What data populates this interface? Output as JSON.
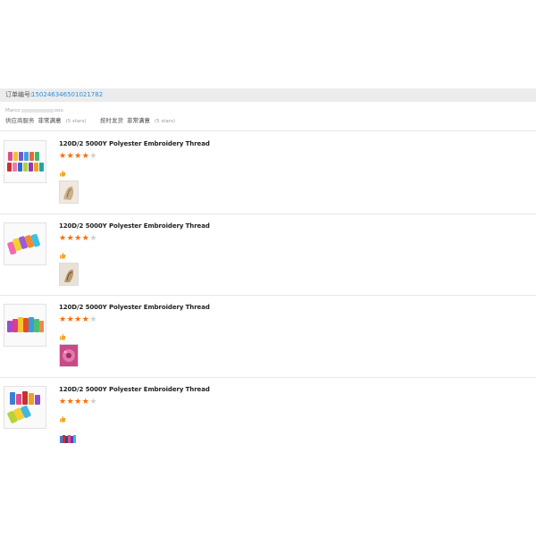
{
  "order": {
    "label": "订单编号:",
    "number": "150246346501021782"
  },
  "buyer": {
    "prefix": "Marco",
    "suffix": "ooo"
  },
  "supplier_ratings": [
    {
      "label": "供应商服务",
      "value": "非常满意",
      "stars": "(5 stars)"
    },
    {
      "label": "按时发货",
      "value": "非常满意",
      "stars": "(5 stars)"
    }
  ],
  "products": [
    {
      "title": "120D/2 5000Y Polyester Embroidery Thread",
      "rating": 4,
      "max_rating": 5,
      "thumb_icon": "thread-spools-image",
      "photo_icon": "review-photo"
    },
    {
      "title": "120D/2 5000Y Polyester Embroidery Thread",
      "rating": 4,
      "max_rating": 5,
      "thumb_icon": "thread-spools-image",
      "photo_icon": "review-photo"
    },
    {
      "title": "120D/2 5000Y Polyester Embroidery Thread",
      "rating": 4,
      "max_rating": 5,
      "thumb_icon": "thread-spools-image",
      "photo_icon": "review-photo"
    },
    {
      "title": "120D/2 5000Y Polyester Embroidery Thread",
      "rating": 4,
      "max_rating": 5,
      "thumb_icon": "thread-spools-image",
      "photo_icon": "review-photo"
    }
  ],
  "colors": {
    "accent": "#ff6a00",
    "link": "#2e8fd8",
    "thumbs_up": "#f5a623"
  }
}
